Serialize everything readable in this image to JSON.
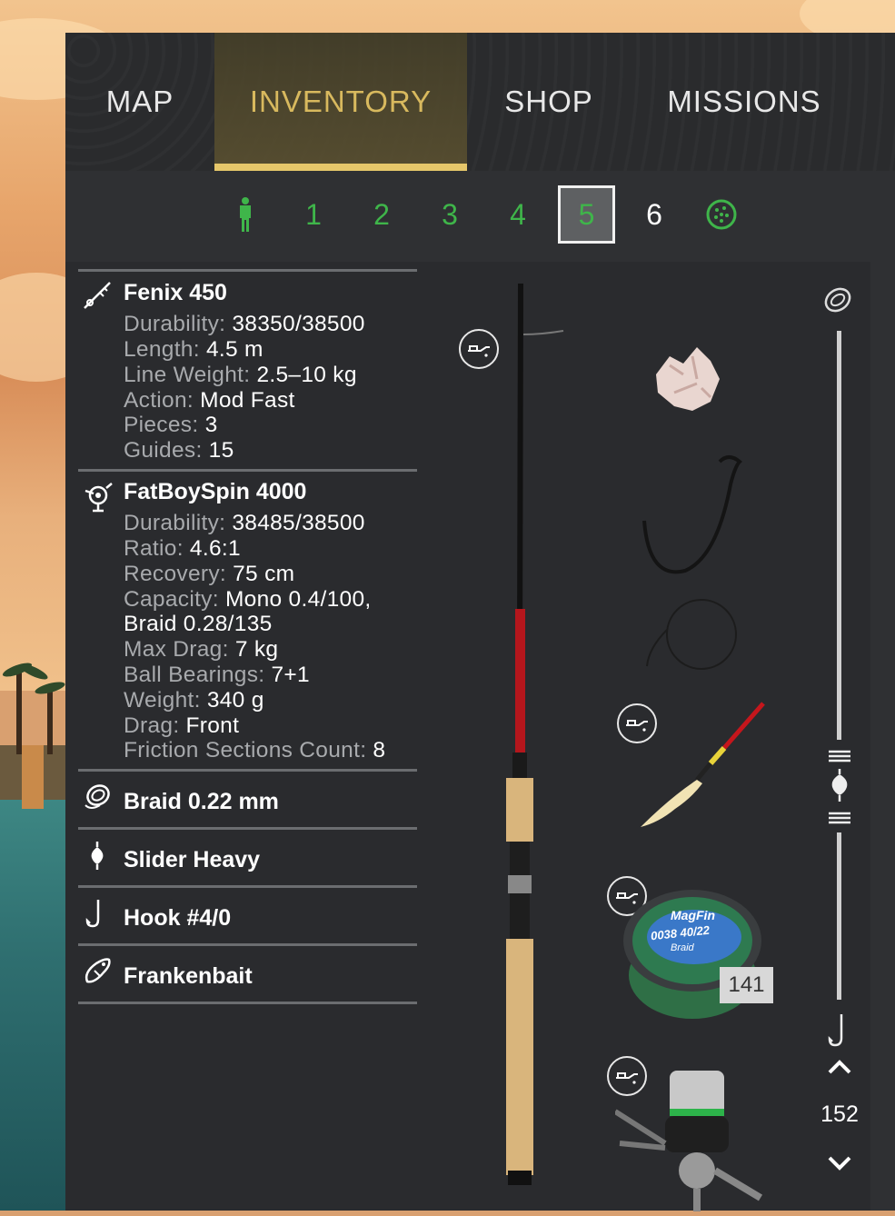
{
  "tabs": [
    {
      "label": "MAP",
      "active": false
    },
    {
      "label": "INVENTORY",
      "active": true
    },
    {
      "label": "SHOP",
      "active": false
    },
    {
      "label": "MISSIONS",
      "active": false
    }
  ],
  "slots": {
    "player_icon": "player-silhouette-icon",
    "numbers": [
      "1",
      "2",
      "3",
      "4",
      "5",
      "6"
    ],
    "selected": "5",
    "last_icon": "groundbait-icon"
  },
  "rod": {
    "name": "Fenix 450",
    "icon": "rod-icon",
    "props": [
      {
        "k": "Durability",
        "v": "38350/38500"
      },
      {
        "k": "Length",
        "v": "4.5 m"
      },
      {
        "k": "Line Weight",
        "v": "2.5–10 kg"
      },
      {
        "k": "Action",
        "v": "Mod Fast"
      },
      {
        "k": "Pieces",
        "v": "3"
      },
      {
        "k": "Guides",
        "v": "15"
      }
    ]
  },
  "reel": {
    "name": "FatBoySpin 4000",
    "icon": "reel-icon",
    "props": [
      {
        "k": "Durability",
        "v": "38485/38500"
      },
      {
        "k": "Ratio",
        "v": "4.6:1"
      },
      {
        "k": "Recovery",
        "v": "75 cm"
      },
      {
        "k": "Capacity",
        "v": "Mono 0.4/100,"
      },
      {
        "k": "",
        "v": "Braid 0.28/135"
      },
      {
        "k": "Max Drag",
        "v": "7 kg"
      },
      {
        "k": "Ball Bearings",
        "v": "7+1"
      },
      {
        "k": "Weight",
        "v": "340 g"
      },
      {
        "k": "Drag",
        "v": "Front"
      },
      {
        "k": "Friction Sections Count",
        "v": "8"
      }
    ]
  },
  "line": {
    "name": "Braid 0.22 mm",
    "icon": "line-spool-icon"
  },
  "float": {
    "name": "Slider Heavy",
    "icon": "float-icon"
  },
  "hook": {
    "name": "Hook #4/0",
    "icon": "hook-icon"
  },
  "bait": {
    "name": "Frankenbait",
    "icon": "bait-icon"
  },
  "gear": {
    "spool_label_brand": "MagFin",
    "spool_label_size": "0038 40/22",
    "spool_label_type": "Braid",
    "line_count": "141"
  },
  "depth": {
    "value": "152"
  }
}
